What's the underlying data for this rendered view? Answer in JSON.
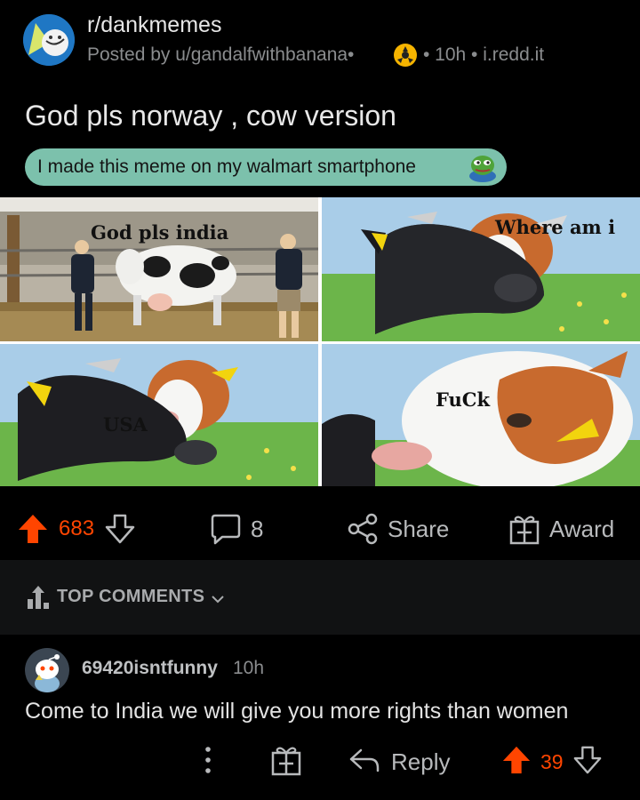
{
  "post": {
    "subreddit": "r/dankmemes",
    "posted_by": "Posted by u/gandalfwithbanana•",
    "meta_rest": "• 10h • i.redd.it",
    "title": "God pls norway , cow version",
    "flair": "I made this meme on my walmart smartphone"
  },
  "meme": {
    "panels": [
      {
        "caption": "God pls india"
      },
      {
        "caption": "Where am i"
      },
      {
        "caption": "USA"
      },
      {
        "caption": "FuCk"
      }
    ]
  },
  "actions": {
    "upvotes": "683",
    "comments": "8",
    "share": "Share",
    "award": "Award"
  },
  "comments_section": {
    "sort_label": "TOP COMMENTS"
  },
  "comment": {
    "username": "69420isntfunny",
    "time": "10h",
    "body": "Come to India we will give you more rights than women",
    "reply": "Reply",
    "votes": "39"
  },
  "colors": {
    "upvote": "#ff4500",
    "flair_bg": "#7cc1ac",
    "background": "#000000"
  }
}
